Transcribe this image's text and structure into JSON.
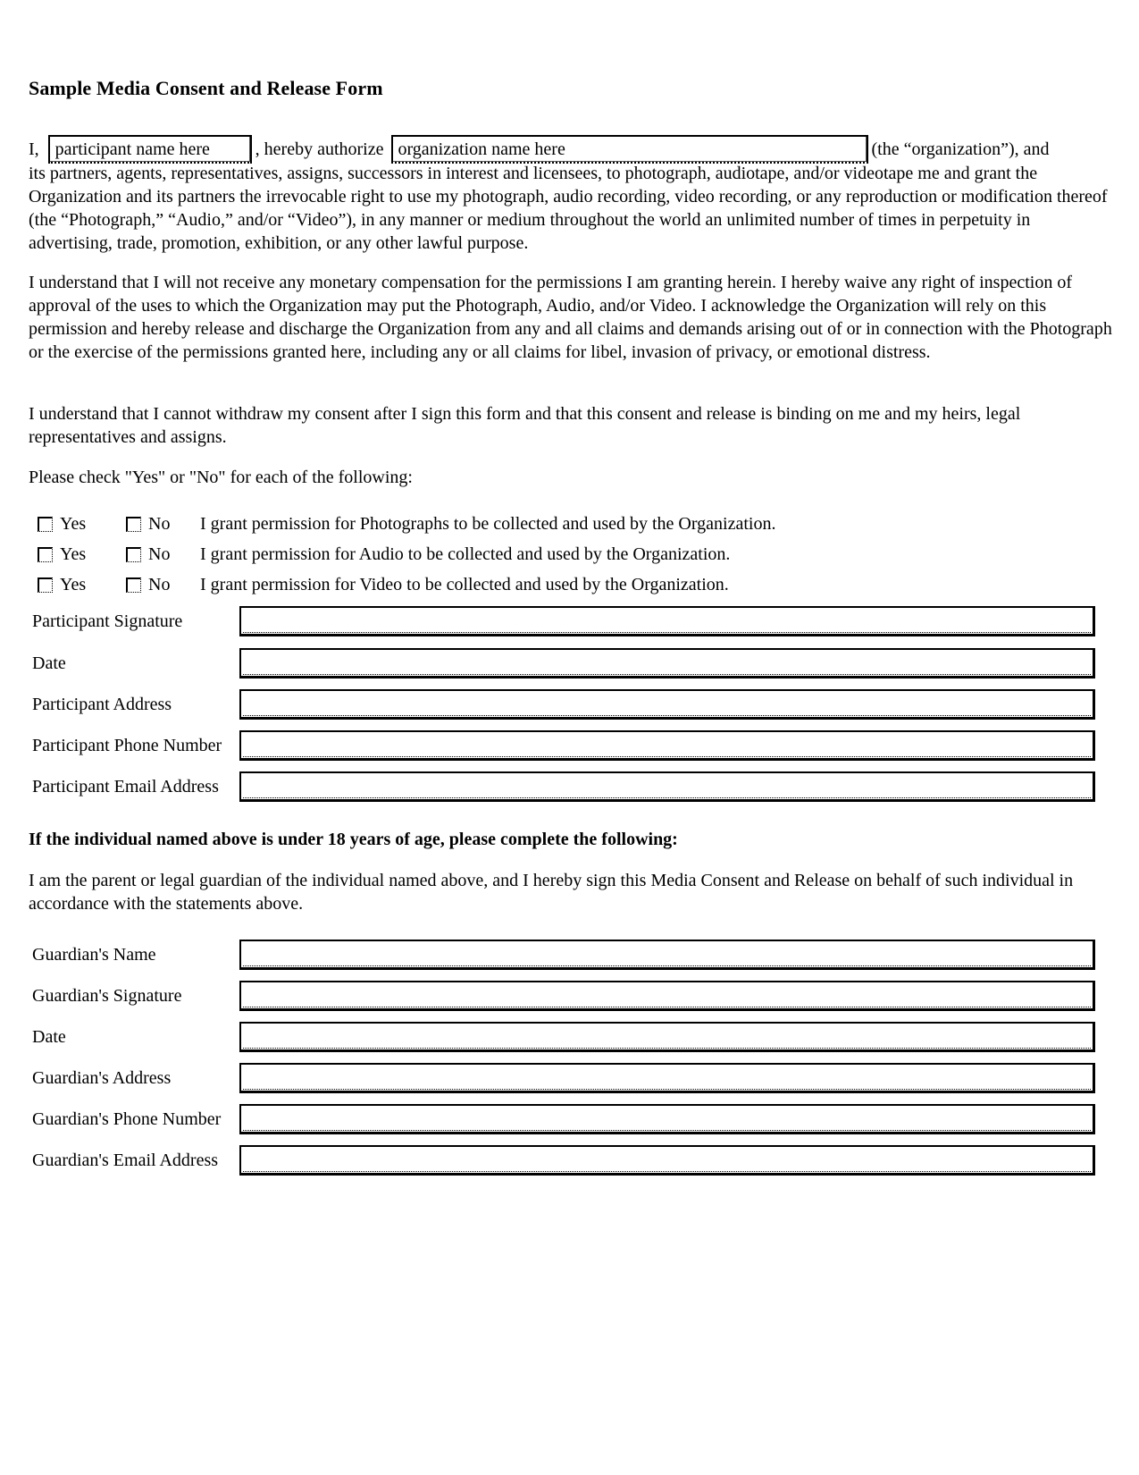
{
  "document": {
    "title": "Sample Media Consent and Release Form",
    "intro": {
      "prefix": "I,",
      "participant_field_value": "participant name here",
      "middle": ", hereby authorize",
      "organization_field_value": "organization name here",
      "suffix": "(the “organization”), and"
    },
    "paragraph1_cont": "its partners, agents, representatives, assigns, successors in interest and licensees, to photograph, audiotape, and/or videotape me and grant the Organization and its partners the irrevocable right to use my photograph, audio recording, video recording, or any reproduction or modification thereof (the “Photograph,” “Audio,” and/or “Video”), in any manner or medium throughout the world an unlimited number of times in perpetuity in advertising, trade, promotion, exhibition, or any other lawful purpose.",
    "paragraph2": "I understand that I will not receive any monetary compensation for the permissions I am granting herein. I hereby waive any right of inspection of approval of the uses to which the Organization may put the Photograph, Audio, and/or Video. I acknowledge the Organization will rely on this permission and hereby release and discharge the Organization from any and all claims and demands arising out of or in connection with the Photograph or the exercise of the permissions granted here, including any or all claims for libel, invasion of privacy, or emotional distress.",
    "paragraph3": "I understand that I cannot withdraw my consent after I sign this form and that this consent and release is binding on me and my heirs, legal representatives and assigns.",
    "check_instruction": "Please check \"Yes\" or \"No\" for each of the following:",
    "permissions": [
      {
        "yes_label": "Yes",
        "no_label": "No",
        "text": "I grant permission for Photographs to be collected and used by the Organization.",
        "yes_checked": false,
        "no_checked": false
      },
      {
        "yes_label": "Yes",
        "no_label": "No",
        "text": "I grant permission for Audio to be collected and used by the Organization.",
        "yes_checked": false,
        "no_checked": false
      },
      {
        "yes_label": "Yes",
        "no_label": "No",
        "text": "I grant permission for Video to be collected and used by the Organization.",
        "yes_checked": false,
        "no_checked": false
      }
    ],
    "participant_fields": [
      {
        "label": "Participant Signature",
        "value": ""
      },
      {
        "label": "Date",
        "value": ""
      },
      {
        "label": "Participant Address",
        "value": ""
      },
      {
        "label": "Participant Phone Number",
        "value": ""
      },
      {
        "label": "Participant Email Address",
        "value": ""
      }
    ],
    "minor_heading": "If the individual named above is under 18 years of age, please complete the following:",
    "guardian_statement": "I am the parent or legal guardian of the individual named above, and I hereby sign this Media Consent and Release on behalf of such individual in accordance with the statements above.",
    "guardian_fields": [
      {
        "label": "Guardian's Name",
        "value": ""
      },
      {
        "label": "Guardian's Signature",
        "value": ""
      },
      {
        "label": "Date",
        "value": ""
      },
      {
        "label": "Guardian's Address",
        "value": ""
      },
      {
        "label": "Guardian's Phone Number",
        "value": ""
      },
      {
        "label": "Guardian's Email Address",
        "value": ""
      }
    ]
  }
}
